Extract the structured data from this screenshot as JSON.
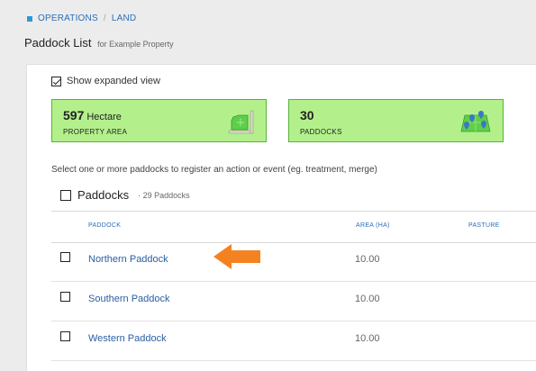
{
  "breadcrumb": {
    "items": [
      "OPERATIONS",
      "LAND"
    ],
    "separator": "/"
  },
  "page": {
    "title": "Paddock List",
    "subtitle": "for Example Property"
  },
  "expanded_view": {
    "label": "Show expanded view",
    "checked": true
  },
  "cards": [
    {
      "value": "597",
      "unit": "Hectare",
      "label": "PROPERTY AREA",
      "icon": "land-area-icon"
    },
    {
      "value": "30",
      "unit": "",
      "label": "PADDOCKS",
      "icon": "map-pins-icon"
    }
  ],
  "instructions": "Select one or more paddocks to register an action or event (eg. treatment, merge)",
  "paddocks_header": {
    "label": "Paddocks",
    "count": "· 29 Paddocks"
  },
  "table": {
    "columns": [
      "PADDOCK",
      "AREA (HA)",
      "PASTURE"
    ],
    "rows": [
      {
        "name": "Northern Paddock",
        "area": "10.00",
        "pasture": ""
      },
      {
        "name": "Southern Paddock",
        "area": "10.00",
        "pasture": ""
      },
      {
        "name": "Western Paddock",
        "area": "10.00",
        "pasture": ""
      }
    ]
  },
  "colors": {
    "card_bg": "#b3f08c",
    "card_border": "#58b33b",
    "link": "#2a5ea3",
    "arrow": "#f58220"
  }
}
